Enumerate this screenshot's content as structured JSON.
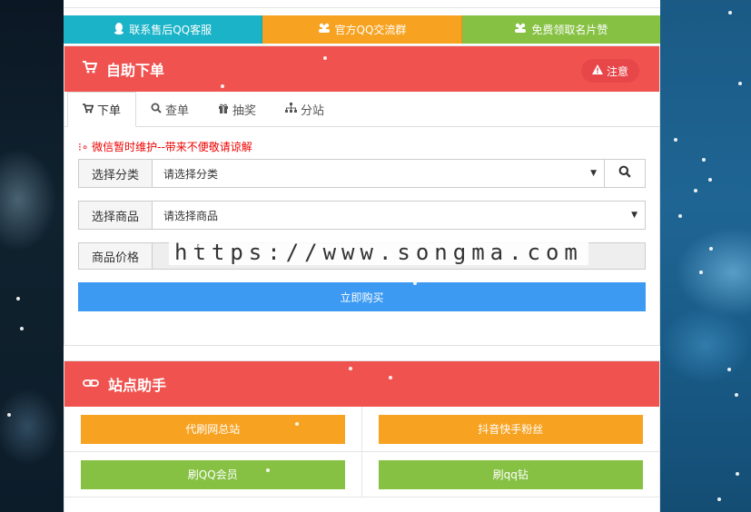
{
  "colors": {
    "contact_cyan": "#1ab3c8",
    "contact_orange": "#f7a221",
    "contact_green": "#86c143",
    "panel_red": "#f0534f",
    "buy_blue": "#3c9af3",
    "helper_orange": "#f7a221",
    "helper_green": "#86c143"
  },
  "contact_bar": [
    {
      "label": "联系售后QQ客服",
      "icon": "qq-penguin-icon"
    },
    {
      "label": "官方QQ交流群",
      "icon": "group-icon"
    },
    {
      "label": "免费领取名片赞",
      "icon": "group-icon"
    }
  ],
  "order_panel": {
    "title": "自助下单",
    "icon": "cart-icon",
    "notice_label": "注意",
    "tabs": [
      {
        "label": "下单",
        "icon": "cart-icon"
      },
      {
        "label": "查单",
        "icon": "search-icon"
      },
      {
        "label": "抽奖",
        "icon": "gift-icon"
      },
      {
        "label": "分站",
        "icon": "sitemap-icon"
      }
    ],
    "warning": "微信暂时维护--带来不便敬请谅解",
    "category_label": "选择分类",
    "category_value": "请选择分类",
    "product_label": "选择商品",
    "product_value": "请选择商品",
    "price_label": "商品价格",
    "watermark": "https://www.songma.com",
    "buy_label": "立即购买"
  },
  "helper_panel": {
    "title": "站点助手",
    "icon": "link-icon",
    "buttons": [
      {
        "label": "代刷网总站"
      },
      {
        "label": "抖音快手粉丝"
      },
      {
        "label": "刷QQ会员"
      },
      {
        "label": "刷qq钻"
      }
    ]
  }
}
